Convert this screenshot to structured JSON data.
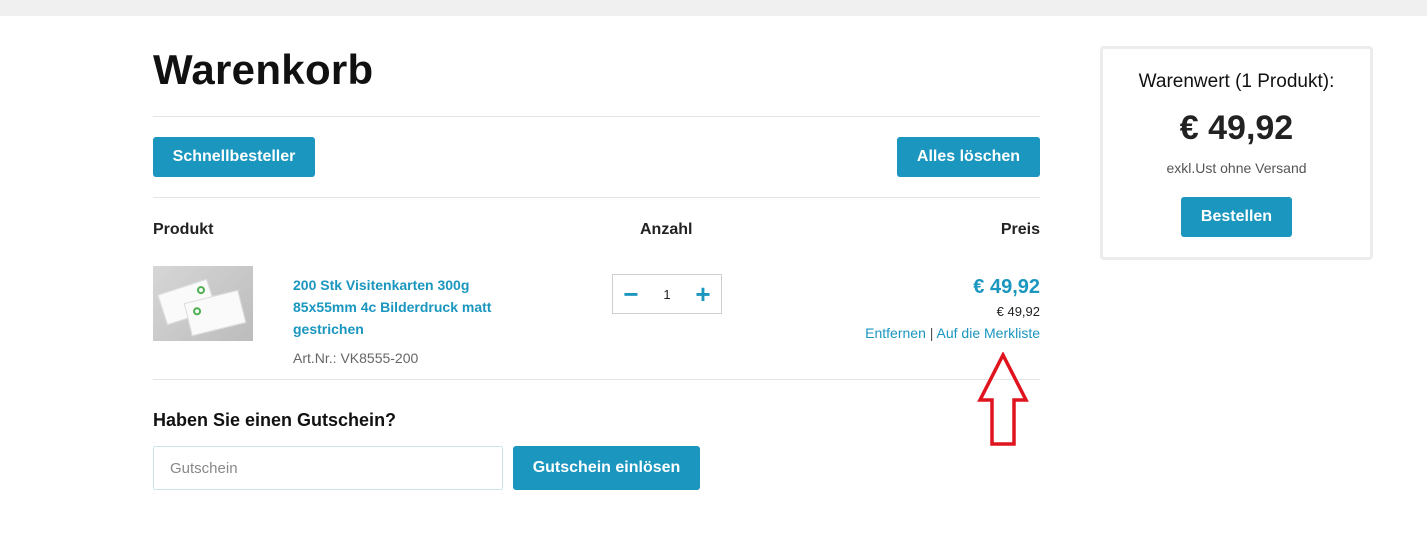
{
  "page": {
    "title": "Warenkorb"
  },
  "toolbar": {
    "quick_order_label": "Schnellbesteller",
    "clear_all_label": "Alles löschen"
  },
  "table": {
    "headers": {
      "product": "Produkt",
      "quantity": "Anzahl",
      "price": "Preis"
    }
  },
  "cart_items": [
    {
      "name": "200 Stk Visitenkarten 300g 85x55mm 4c Bilderdruck matt gestrichen",
      "article_number": "Art.Nr.: VK8555-200",
      "quantity": "1",
      "price": "€ 49,92",
      "unit_price": "€ 49,92",
      "remove_label": "Entfernen",
      "separator": "|",
      "wishlist_label": "Auf die Merkliste",
      "image_icon": "business-cards-icon"
    }
  ],
  "quantity_controls": {
    "minus_symbol": "−",
    "plus_symbol": "+"
  },
  "voucher": {
    "title": "Haben Sie einen Gutschein?",
    "placeholder": "Gutschein",
    "value": "",
    "submit_label": "Gutschein einlösen"
  },
  "summary": {
    "label": "Warenwert (1 Produkt):",
    "total": "€ 49,92",
    "note": "exkl.Ust ohne Versand",
    "order_label": "Bestellen"
  },
  "colors": {
    "accent": "#1a96bf",
    "annotation_arrow": "#e0141e",
    "divider": "#e4e4e4"
  }
}
